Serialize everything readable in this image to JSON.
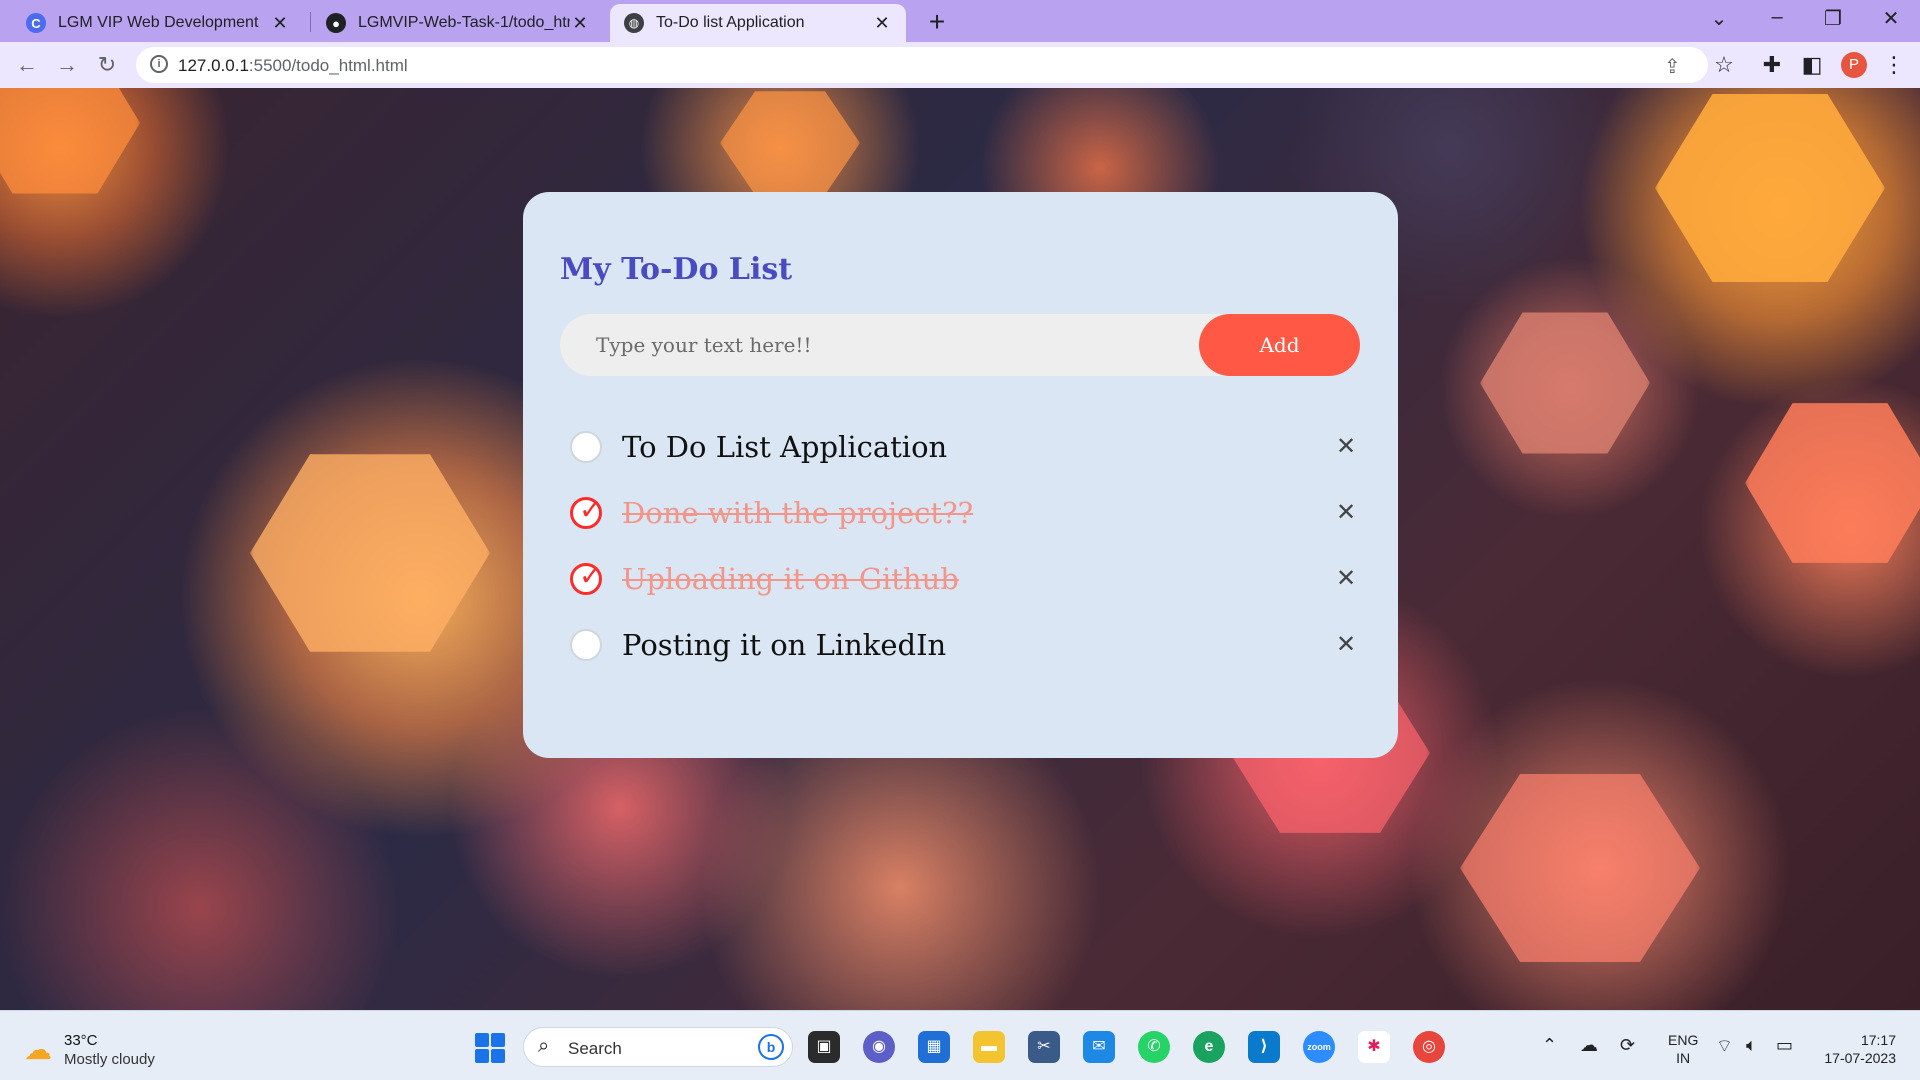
{
  "browser": {
    "tabs": [
      {
        "title": "LGM VIP Web Development",
        "favicon": "C"
      },
      {
        "title": "LGMVIP-Web-Task-1/todo_html.h",
        "favicon": "github-icon"
      },
      {
        "title": "To-Do list Application",
        "favicon": "globe-icon"
      }
    ],
    "active_tab": 2,
    "url_host": "127.0.0.1",
    "url_rest": ":5500/todo_html.html",
    "profile_initial": "P"
  },
  "todo": {
    "title": "My To-Do List",
    "input_placeholder": "Type your text here!!",
    "add_label": "Add",
    "tasks": [
      {
        "text": "To Do List Application",
        "done": false
      },
      {
        "text": "Done with the project??",
        "done": true
      },
      {
        "text": "Uploading it on Github",
        "done": true
      },
      {
        "text": "Posting it on LinkedIn",
        "done": false
      }
    ],
    "colors": {
      "accent": "#ff5945",
      "title": "#4a4ac2",
      "card": "#dae6f3",
      "done_text": "#f3968a"
    }
  },
  "taskbar": {
    "weather_temp": "33°C",
    "weather_desc": "Mostly cloudy",
    "search_label": "Search",
    "lang_1": "ENG",
    "lang_2": "IN",
    "time": "17:17",
    "date": "17-07-2023"
  }
}
